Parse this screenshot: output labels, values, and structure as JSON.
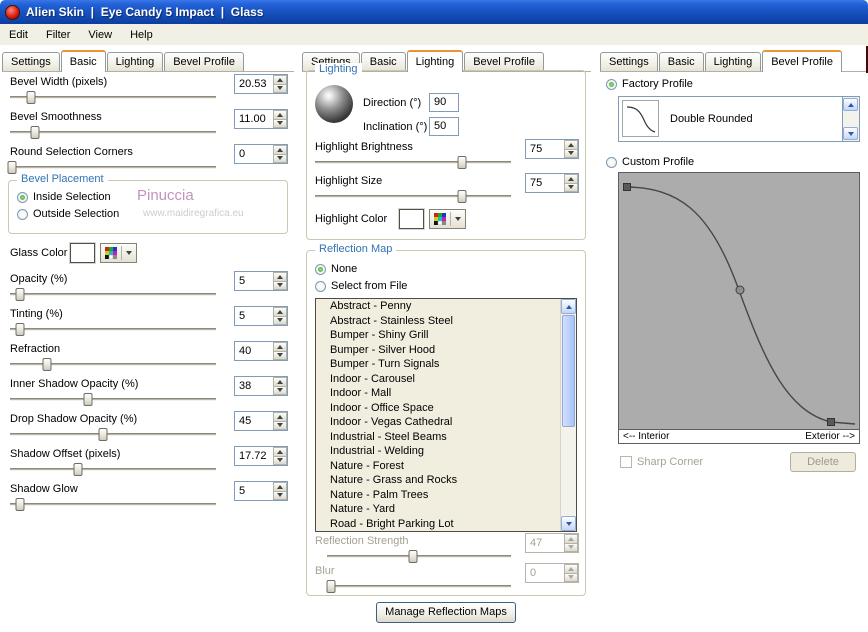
{
  "titlebar": {
    "title": "Alien Skin  |  Eye Candy 5 Impact  |  Glass"
  },
  "menubar": {
    "items": [
      "Edit",
      "Filter",
      "View",
      "Help"
    ]
  },
  "left_panel": {
    "tabs": [
      "Settings",
      "Basic",
      "Lighting",
      "Bevel Profile"
    ],
    "active_tab": "Basic",
    "sliders_top": [
      {
        "label": "Bevel Width (pixels)",
        "value": "20.53",
        "pos": 0.1
      },
      {
        "label": "Bevel Smoothness",
        "value": "11.00",
        "pos": 0.12
      },
      {
        "label": "Round Selection Corners",
        "value": "0",
        "pos": 0.01
      }
    ],
    "bevel_placement": {
      "title": "Bevel Placement",
      "options": [
        "Inside Selection",
        "Outside Selection"
      ],
      "selected": "Inside Selection"
    },
    "watermark": {
      "name": "Pinuccia",
      "url": "www.maidiregrafica.eu"
    },
    "glass_color": {
      "label": "Glass Color",
      "color": "#FFFFFF"
    },
    "sliders_bottom": [
      {
        "label": "Opacity (%)",
        "value": "5",
        "pos": 0.05
      },
      {
        "label": "Tinting (%)",
        "value": "5",
        "pos": 0.05
      },
      {
        "label": "Refraction",
        "value": "40",
        "pos": 0.18
      },
      {
        "label": "Inner Shadow Opacity (%)",
        "value": "38",
        "pos": 0.38
      },
      {
        "label": "Drop Shadow Opacity (%)",
        "value": "45",
        "pos": 0.45
      },
      {
        "label": "Shadow Offset (pixels)",
        "value": "17.72",
        "pos": 0.33
      },
      {
        "label": "Shadow Glow",
        "value": "5",
        "pos": 0.05
      }
    ]
  },
  "middle_panel": {
    "tabs": [
      "Settings",
      "Basic",
      "Lighting",
      "Bevel Profile"
    ],
    "active_tab": "Lighting",
    "lighting": {
      "title": "Lighting",
      "direction": {
        "label": "Direction (°)",
        "value": "90"
      },
      "inclination": {
        "label": "Inclination (°)",
        "value": "50"
      },
      "sliders": [
        {
          "label": "Highlight Brightness",
          "value": "75",
          "pos": 0.75
        },
        {
          "label": "Highlight Size",
          "value": "75",
          "pos": 0.75
        }
      ],
      "highlight_color": {
        "label": "Highlight Color",
        "color": "#FFFFFF"
      }
    },
    "reflection_map": {
      "title": "Reflection Map",
      "options": [
        "None",
        "Select from File"
      ],
      "selected": "None",
      "maps": [
        "Abstract - Penny",
        "Abstract - Stainless Steel",
        "Bumper - Shiny Grill",
        "Bumper - Silver Hood",
        "Bumper - Turn Signals",
        "Indoor - Carousel",
        "Indoor - Mall",
        "Indoor - Office Space",
        "Indoor - Vegas Cathedral",
        "Industrial - Steel Beams",
        "Industrial - Welding",
        "Nature - Forest",
        "Nature - Grass and Rocks",
        "Nature - Palm Trees",
        "Nature - Yard",
        "Road - Bright Parking Lot"
      ],
      "reflection_strength": {
        "label": "Reflection Strength",
        "value": "47",
        "pos": 0.47,
        "disabled": true
      },
      "blur": {
        "label": "Blur",
        "value": "0",
        "pos": 0.02,
        "disabled": true
      }
    },
    "manage_button": "Manage Reflection Maps"
  },
  "right_panel": {
    "tabs": [
      "Settings",
      "Basic",
      "Lighting",
      "Bevel Profile"
    ],
    "active_tab": "Bevel Profile",
    "factory_profile": {
      "label": "Factory Profile",
      "selected": true,
      "profile_name": "Double Rounded"
    },
    "custom_profile": {
      "label": "Custom Profile",
      "selected": false
    },
    "curve_labels": {
      "interior": "<-- Interior",
      "exterior": "Exterior -->"
    },
    "sharp_corner": {
      "label": "Sharp Corner",
      "checked": false,
      "disabled": true
    },
    "delete_button": {
      "label": "Delete",
      "disabled": true
    }
  }
}
